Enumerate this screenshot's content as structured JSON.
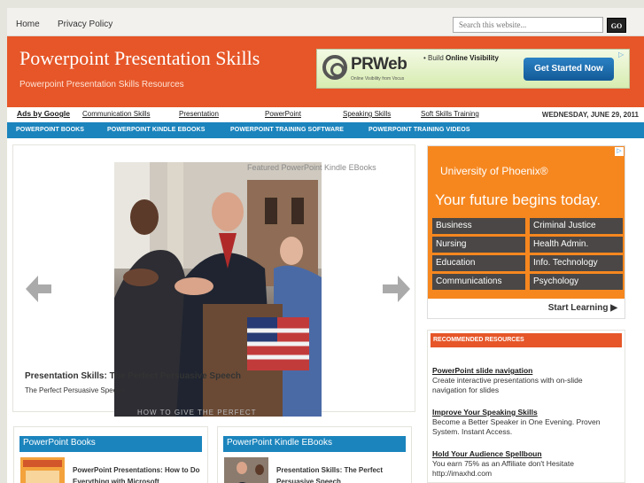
{
  "topnav": {
    "home": "Home",
    "privacy": "Privacy Policy"
  },
  "search": {
    "placeholder": "Search this website...",
    "go": "GO"
  },
  "header": {
    "title": "Powerpoint Presentation Skills",
    "tagline": "Powerpoint Presentation Skills Resources"
  },
  "header_ad": {
    "brand": "PRWeb",
    "sub": "Online Visibility from Vocus",
    "bullet_prefix": "• Build ",
    "bullet_bold": "Online Visibility",
    "button": "Get Started Now",
    "info": "▷"
  },
  "linkrow": {
    "ads_by": "Ads by Google",
    "links": [
      "Communication Skills",
      "Presentation",
      "PowerPoint",
      "Speaking Skills",
      "Soft Skills Training"
    ],
    "date": "WEDNESDAY, JUNE 29, 2011"
  },
  "bluenav": [
    "POWERPOINT BOOKS",
    "POWERPOINT KINDLE EBOOKS",
    "POWERPOINT TRAINING SOFTWARE",
    "POWERPOINT TRAINING VIDEOS"
  ],
  "featured": {
    "label": "Featured PowerPoint Kindle EBooks",
    "caption_title": "Presentation Skills: The Perfect Persuasive Speech",
    "caption_sub": "The Perfect Persuasive Speech",
    "bottom_text": "HOW TO GIVE THE PERFECT"
  },
  "uop_ad": {
    "logo": "University of Phoenix®",
    "headline": "Your future begins today.",
    "cells": [
      "Business",
      "Criminal Justice",
      "Nursing",
      "Health Admin.",
      "Education",
      "Info. Technology",
      "Communications",
      "Psychology"
    ],
    "learn": "Start Learning ▶",
    "badge": "▷"
  },
  "recommended": {
    "heading": "RECOMMENDED RESOURCES",
    "items": [
      {
        "title": "PowerPoint slide navigation",
        "text": "Create interactive presentations with on-slide navigation for slides"
      },
      {
        "title": "Improve Your Speaking Skills",
        "text": "Become a Better Speaker in One Evening. Proven System. Instant Access."
      },
      {
        "title": "Hold Your Audience Spellboun",
        "text": "You earn 75% as an Affiliate don't Hesitate http://imaxhd.com"
      }
    ]
  },
  "boxes": [
    {
      "heading": "PowerPoint Books",
      "title": "PowerPoint Presentations: How to Do Everything with Microsoft"
    },
    {
      "heading": "PowerPoint Kindle EBooks",
      "title": "Presentation Skills: The Perfect Persuasive Speech"
    }
  ],
  "colors": {
    "header": "#e65628",
    "nav": "#1b84bd",
    "uop": "#f6871f"
  }
}
